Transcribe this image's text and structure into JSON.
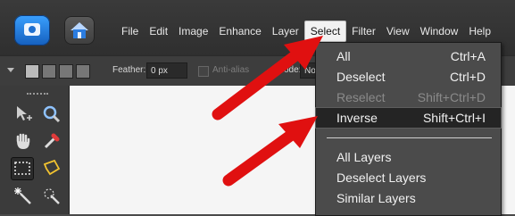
{
  "menubar": {
    "items": [
      "File",
      "Edit",
      "Image",
      "Enhance",
      "Layer",
      "Select",
      "Filter",
      "View",
      "Window",
      "Help"
    ],
    "active": "Select"
  },
  "options_bar": {
    "feather_label": "Feather:",
    "feather_value": "0 px",
    "antialias_label": "Anti-alias",
    "mode_label": "ode:",
    "mode_value": "No"
  },
  "select_menu": {
    "items": [
      {
        "label": "All",
        "shortcut": "Ctrl+A",
        "state": "normal"
      },
      {
        "label": "Deselect",
        "shortcut": "Ctrl+D",
        "state": "normal"
      },
      {
        "label": "Reselect",
        "shortcut": "Shift+Ctrl+D",
        "state": "disabled"
      },
      {
        "label": "Inverse",
        "shortcut": "Shift+Ctrl+I",
        "state": "highlighted"
      },
      {
        "label": "All Layers",
        "shortcut": "",
        "state": "normal"
      },
      {
        "label": "Deselect Layers",
        "shortcut": "",
        "state": "normal"
      },
      {
        "label": "Similar Layers",
        "shortcut": "",
        "state": "normal"
      }
    ]
  },
  "colors": {
    "annotation_arrow": "#e01010",
    "app_button": "#1f73d6"
  }
}
